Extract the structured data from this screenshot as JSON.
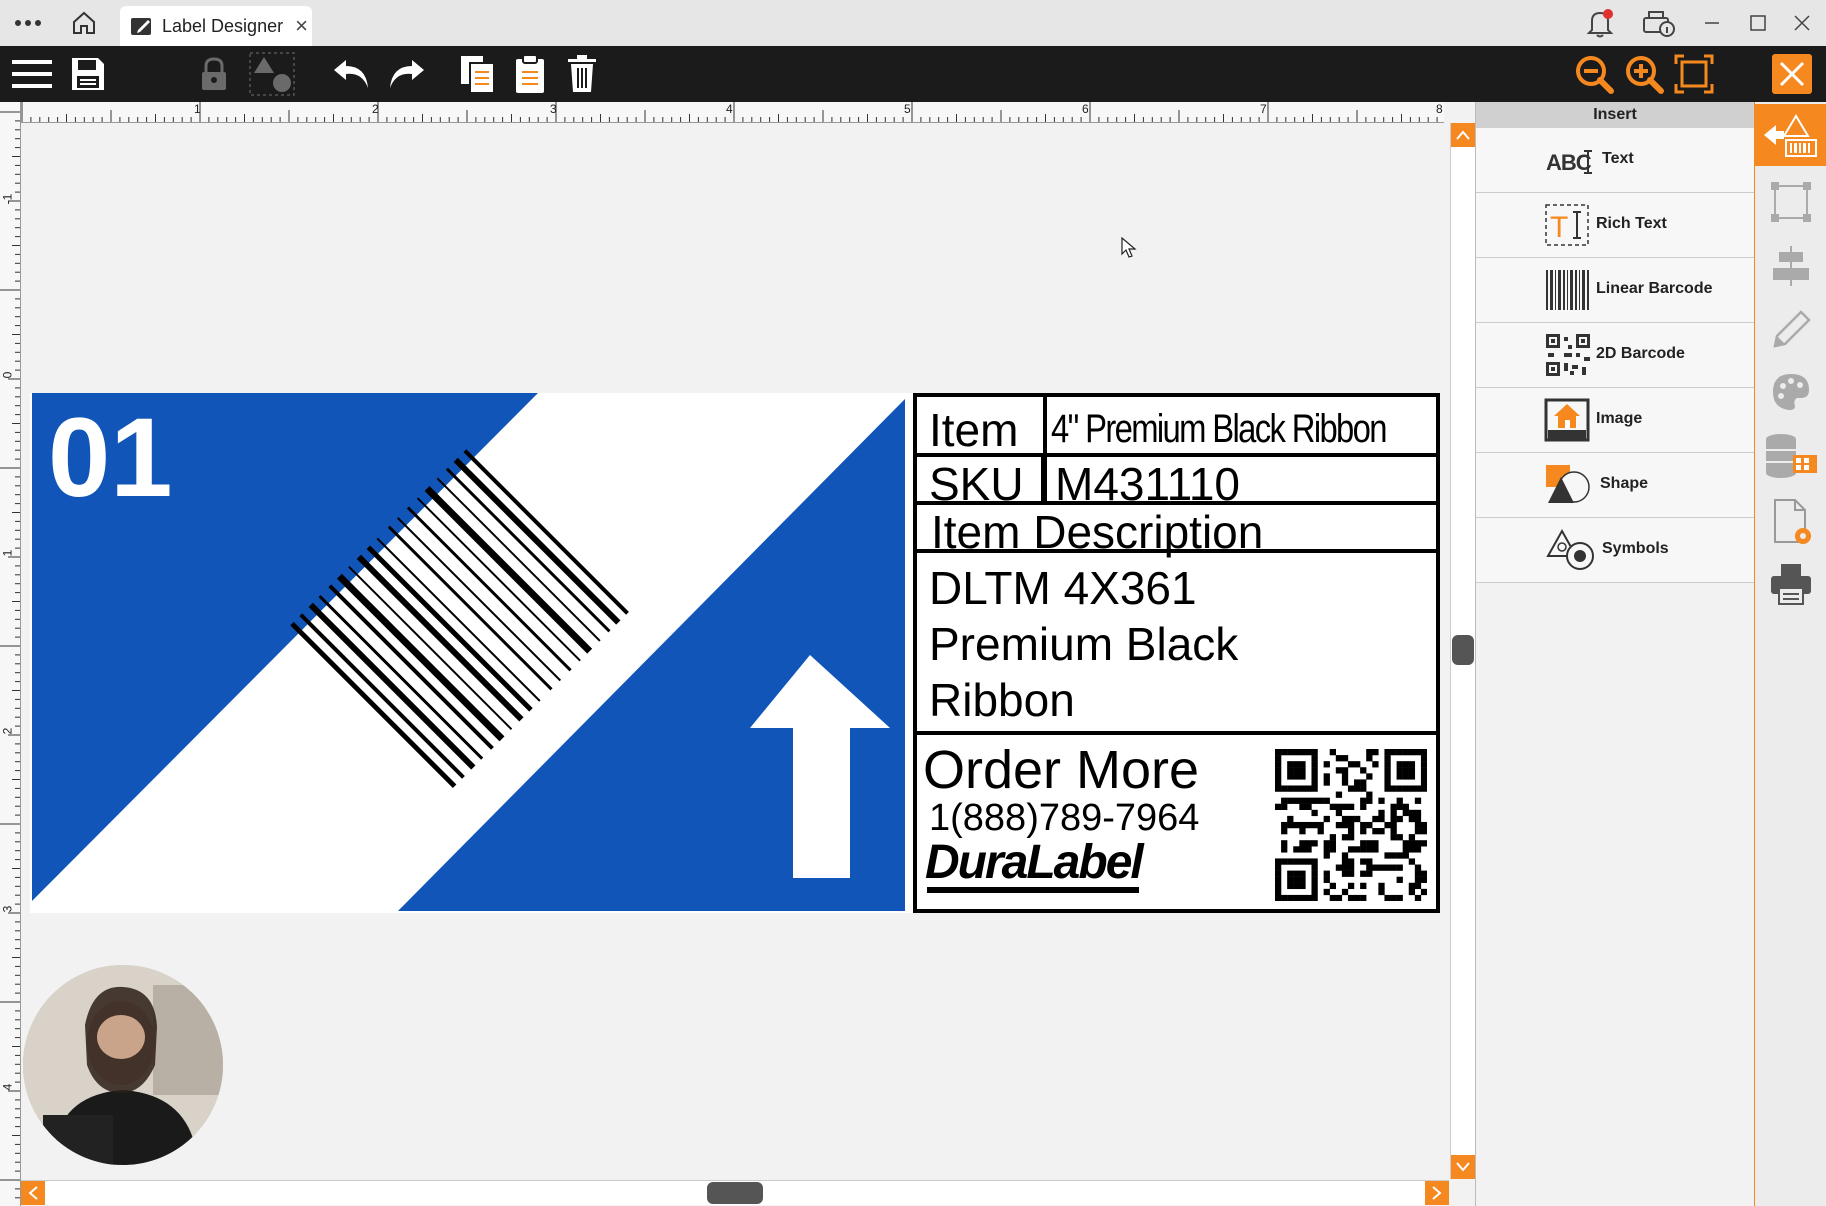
{
  "window": {
    "tab_title": "Label Designer",
    "tab_close": "×"
  },
  "label": {
    "number": "01",
    "table": {
      "item_label": "Item",
      "item_value": "4\" Premium Black Ribbon",
      "sku_label": "SKU",
      "sku_value": "M431110",
      "desc_header": "Item Description",
      "desc_line1": "DLTM 4X361",
      "desc_line2": "Premium Black",
      "desc_line3": "Ribbon",
      "order_more": "Order More",
      "phone": "1(888)789-7964",
      "brand": "DuraLabel"
    }
  },
  "rulers": {
    "h_ticks": [
      "1",
      "2",
      "3",
      "4",
      "5",
      "6",
      "7",
      "8"
    ],
    "v_ticks": [
      "-1",
      "0",
      "1",
      "2",
      "3",
      "4"
    ]
  },
  "insert_panel": {
    "title": "Insert",
    "items": [
      {
        "label": "Text",
        "icon": "text-abc-icon"
      },
      {
        "label": "Rich Text",
        "icon": "rich-text-icon"
      },
      {
        "label": "Linear Barcode",
        "icon": "linear-barcode-icon"
      },
      {
        "label": "2D Barcode",
        "icon": "qr-code-icon"
      },
      {
        "label": "Image",
        "icon": "image-icon"
      },
      {
        "label": "Shape",
        "icon": "shape-icon"
      },
      {
        "label": "Symbols",
        "icon": "symbols-icon"
      }
    ]
  },
  "colors": {
    "accent": "#f5881f",
    "label_blue": "#1155b8",
    "toolbar": "#1b1b1b"
  }
}
